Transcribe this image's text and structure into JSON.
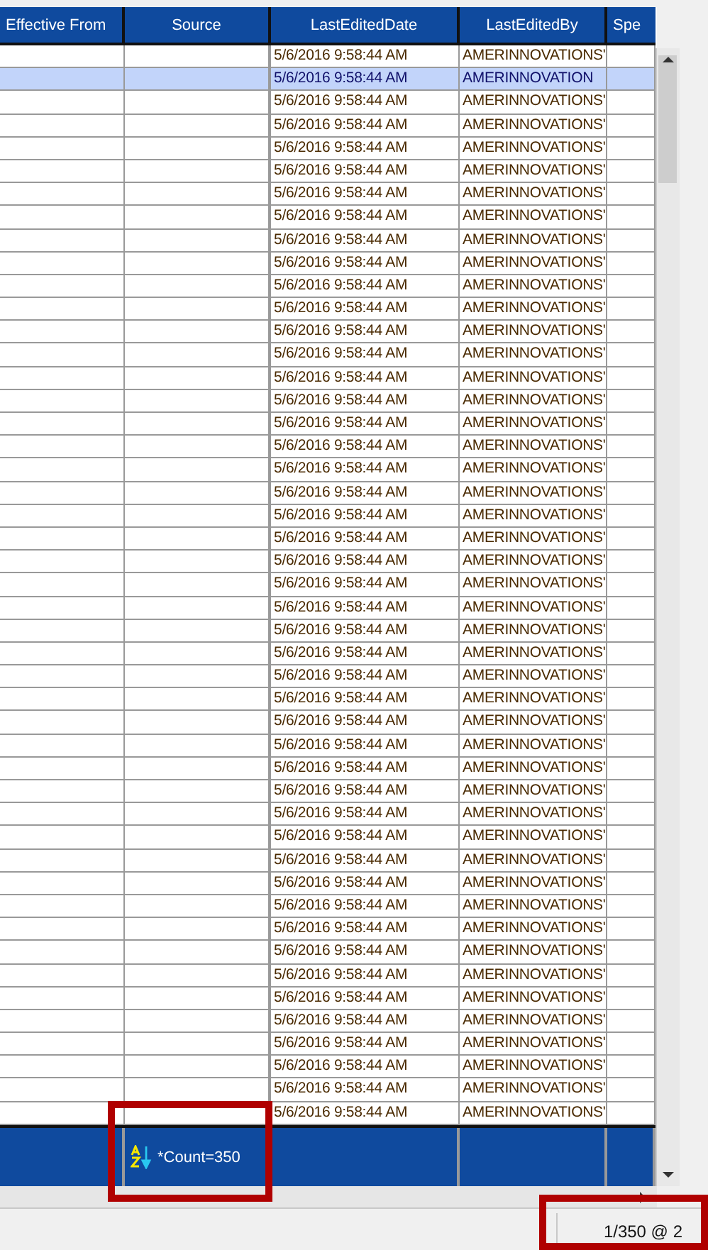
{
  "grid": {
    "columns": [
      {
        "label": "Effective From"
      },
      {
        "label": "Source"
      },
      {
        "label": "LastEditedDate"
      },
      {
        "label": "LastEditedBy"
      },
      {
        "label": "Spe"
      }
    ],
    "rows": [
      {
        "last_edited_date": "5/6/2016 9:58:44 AM",
        "last_edited_by": "AMERINNOVATIONS'",
        "selected": false
      },
      {
        "last_edited_date": "5/6/2016 9:58:44 AM",
        "last_edited_by": "AMERINNOVATION",
        "selected": true
      },
      {
        "last_edited_date": "5/6/2016 9:58:44 AM",
        "last_edited_by": "AMERINNOVATIONS'",
        "selected": false
      },
      {
        "last_edited_date": "5/6/2016 9:58:44 AM",
        "last_edited_by": "AMERINNOVATIONS'",
        "selected": false
      },
      {
        "last_edited_date": "5/6/2016 9:58:44 AM",
        "last_edited_by": "AMERINNOVATIONS'",
        "selected": false
      },
      {
        "last_edited_date": "5/6/2016 9:58:44 AM",
        "last_edited_by": "AMERINNOVATIONS'",
        "selected": false
      },
      {
        "last_edited_date": "5/6/2016 9:58:44 AM",
        "last_edited_by": "AMERINNOVATIONS'",
        "selected": false
      },
      {
        "last_edited_date": "5/6/2016 9:58:44 AM",
        "last_edited_by": "AMERINNOVATIONS'",
        "selected": false
      },
      {
        "last_edited_date": "5/6/2016 9:58:44 AM",
        "last_edited_by": "AMERINNOVATIONS'",
        "selected": false
      },
      {
        "last_edited_date": "5/6/2016 9:58:44 AM",
        "last_edited_by": "AMERINNOVATIONS'",
        "selected": false
      },
      {
        "last_edited_date": "5/6/2016 9:58:44 AM",
        "last_edited_by": "AMERINNOVATIONS'",
        "selected": false
      },
      {
        "last_edited_date": "5/6/2016 9:58:44 AM",
        "last_edited_by": "AMERINNOVATIONS'",
        "selected": false
      },
      {
        "last_edited_date": "5/6/2016 9:58:44 AM",
        "last_edited_by": "AMERINNOVATIONS'",
        "selected": false
      },
      {
        "last_edited_date": "5/6/2016 9:58:44 AM",
        "last_edited_by": "AMERINNOVATIONS'",
        "selected": false
      },
      {
        "last_edited_date": "5/6/2016 9:58:44 AM",
        "last_edited_by": "AMERINNOVATIONS'",
        "selected": false
      },
      {
        "last_edited_date": "5/6/2016 9:58:44 AM",
        "last_edited_by": "AMERINNOVATIONS'",
        "selected": false
      },
      {
        "last_edited_date": "5/6/2016 9:58:44 AM",
        "last_edited_by": "AMERINNOVATIONS'",
        "selected": false
      },
      {
        "last_edited_date": "5/6/2016 9:58:44 AM",
        "last_edited_by": "AMERINNOVATIONS'",
        "selected": false
      },
      {
        "last_edited_date": "5/6/2016 9:58:44 AM",
        "last_edited_by": "AMERINNOVATIONS'",
        "selected": false
      },
      {
        "last_edited_date": "5/6/2016 9:58:44 AM",
        "last_edited_by": "AMERINNOVATIONS'",
        "selected": false
      },
      {
        "last_edited_date": "5/6/2016 9:58:44 AM",
        "last_edited_by": "AMERINNOVATIONS'",
        "selected": false
      },
      {
        "last_edited_date": "5/6/2016 9:58:44 AM",
        "last_edited_by": "AMERINNOVATIONS'",
        "selected": false
      },
      {
        "last_edited_date": "5/6/2016 9:58:44 AM",
        "last_edited_by": "AMERINNOVATIONS'",
        "selected": false
      },
      {
        "last_edited_date": "5/6/2016 9:58:44 AM",
        "last_edited_by": "AMERINNOVATIONS'",
        "selected": false
      },
      {
        "last_edited_date": "5/6/2016 9:58:44 AM",
        "last_edited_by": "AMERINNOVATIONS'",
        "selected": false
      },
      {
        "last_edited_date": "5/6/2016 9:58:44 AM",
        "last_edited_by": "AMERINNOVATIONS'",
        "selected": false
      },
      {
        "last_edited_date": "5/6/2016 9:58:44 AM",
        "last_edited_by": "AMERINNOVATIONS'",
        "selected": false
      },
      {
        "last_edited_date": "5/6/2016 9:58:44 AM",
        "last_edited_by": "AMERINNOVATIONS'",
        "selected": false
      },
      {
        "last_edited_date": "5/6/2016 9:58:44 AM",
        "last_edited_by": "AMERINNOVATIONS'",
        "selected": false
      },
      {
        "last_edited_date": "5/6/2016 9:58:44 AM",
        "last_edited_by": "AMERINNOVATIONS'",
        "selected": false
      },
      {
        "last_edited_date": "5/6/2016 9:58:44 AM",
        "last_edited_by": "AMERINNOVATIONS'",
        "selected": false
      },
      {
        "last_edited_date": "5/6/2016 9:58:44 AM",
        "last_edited_by": "AMERINNOVATIONS'",
        "selected": false
      },
      {
        "last_edited_date": "5/6/2016 9:58:44 AM",
        "last_edited_by": "AMERINNOVATIONS'",
        "selected": false
      },
      {
        "last_edited_date": "5/6/2016 9:58:44 AM",
        "last_edited_by": "AMERINNOVATIONS'",
        "selected": false
      },
      {
        "last_edited_date": "5/6/2016 9:58:44 AM",
        "last_edited_by": "AMERINNOVATIONS'",
        "selected": false
      },
      {
        "last_edited_date": "5/6/2016 9:58:44 AM",
        "last_edited_by": "AMERINNOVATIONS'",
        "selected": false
      },
      {
        "last_edited_date": "5/6/2016 9:58:44 AM",
        "last_edited_by": "AMERINNOVATIONS'",
        "selected": false
      },
      {
        "last_edited_date": "5/6/2016 9:58:44 AM",
        "last_edited_by": "AMERINNOVATIONS'",
        "selected": false
      },
      {
        "last_edited_date": "5/6/2016 9:58:44 AM",
        "last_edited_by": "AMERINNOVATIONS'",
        "selected": false
      },
      {
        "last_edited_date": "5/6/2016 9:58:44 AM",
        "last_edited_by": "AMERINNOVATIONS'",
        "selected": false
      },
      {
        "last_edited_date": "5/6/2016 9:58:44 AM",
        "last_edited_by": "AMERINNOVATIONS'",
        "selected": false
      },
      {
        "last_edited_date": "5/6/2016 9:58:44 AM",
        "last_edited_by": "AMERINNOVATIONS'",
        "selected": false
      },
      {
        "last_edited_date": "5/6/2016 9:58:44 AM",
        "last_edited_by": "AMERINNOVATIONS'",
        "selected": false
      },
      {
        "last_edited_date": "5/6/2016 9:58:44 AM",
        "last_edited_by": "AMERINNOVATIONS'",
        "selected": false
      },
      {
        "last_edited_date": "5/6/2016 9:58:44 AM",
        "last_edited_by": "AMERINNOVATIONS'",
        "selected": false
      },
      {
        "last_edited_date": "5/6/2016 9:58:44 AM",
        "last_edited_by": "AMERINNOVATIONS'",
        "selected": false
      },
      {
        "last_edited_date": "5/6/2016 9:58:44 AM",
        "last_edited_by": "AMERINNOVATIONS'",
        "selected": false
      }
    ],
    "footer": {
      "count": "*Count=350"
    }
  },
  "status_bar": {
    "position": "1/350 @ 2"
  }
}
